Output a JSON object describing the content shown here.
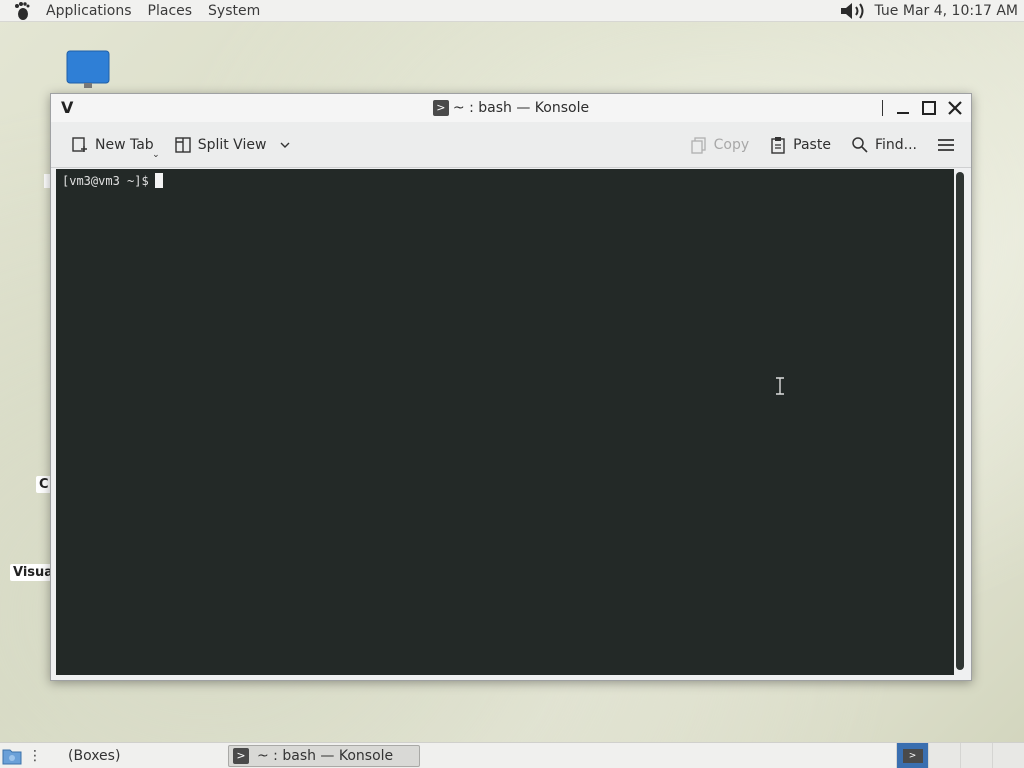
{
  "top_panel": {
    "menus": [
      "Applications",
      "Places",
      "System"
    ],
    "clock": "Tue Mar  4, 10:17 AM"
  },
  "desktop": {
    "labels": [
      "C",
      "Visua"
    ]
  },
  "window": {
    "menu_glyph": "V",
    "title": "~ : bash — Konsole",
    "toolbar": {
      "new_tab": "New Tab",
      "split_view": "Split View",
      "copy": "Copy",
      "paste": "Paste",
      "find": "Find..."
    },
    "terminal": {
      "prompt": "[vm3@vm3 ~]$"
    }
  },
  "bottom_panel": {
    "boxes_label": "(Boxes)",
    "task_label": "~ : bash — Konsole"
  },
  "colors": {
    "terminal_bg": "#232927",
    "workspace_active": "#3a6fb0"
  }
}
